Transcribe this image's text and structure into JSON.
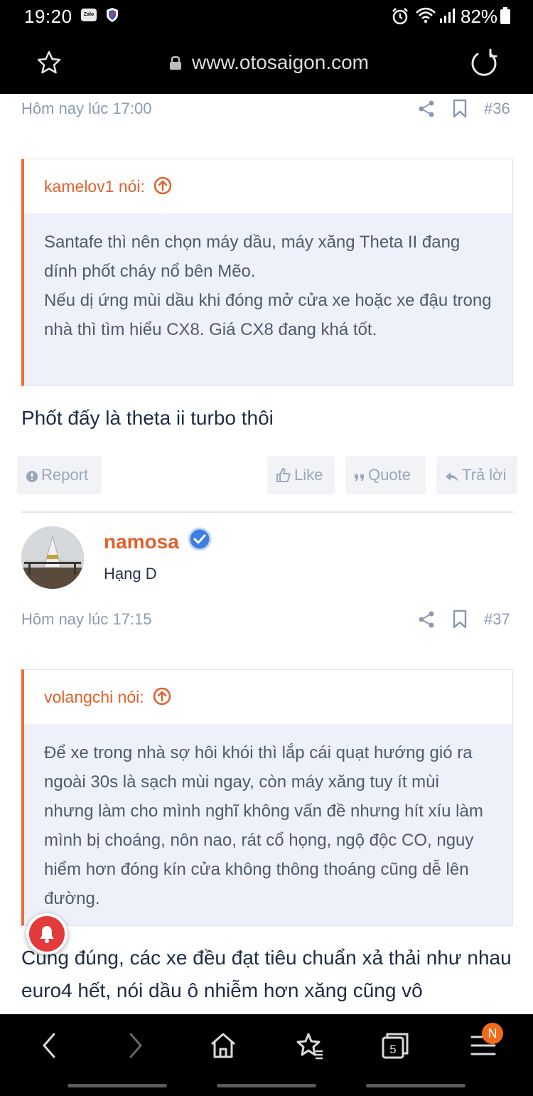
{
  "status_bar": {
    "time": "19:20",
    "zalo_label": "Zalo",
    "battery": "82%"
  },
  "url_bar": {
    "url": "www.otosaigon.com"
  },
  "post36": {
    "time": "Hôm nay lúc 17:00",
    "number": "#36",
    "quote_author": "kamelov1 nói:",
    "quote_text": "Santafe thì nên chọn máy dầu, máy xăng Theta II đang dính phốt cháy nổ bên Mẽo.\nNếu dị ứng mùi dầu khi đóng mở cửa xe hoặc xe đậu trong nhà thì tìm hiểu CX8. Giá CX8 đang khá tốt.",
    "reply_text": "Phốt đấy là theta ii turbo thôi",
    "actions": {
      "report": "Report",
      "like": "Like",
      "quote": "Quote",
      "reply": "Trả lời"
    }
  },
  "post37": {
    "username": "namosa",
    "rank": "Hạng D",
    "time": "Hôm nay lúc 17:15",
    "number": "#37",
    "quote_author": "volangchi nói:",
    "quote_text": "Để xe trong nhà sợ hôi khói thì lắp cái quạt hướng gió ra ngoài 30s là sạch mùi ngay, còn máy xăng tuy ít mùi nhưng làm cho mình nghĩ không vấn đề nhưng hít xíu làm mình bị choáng, nôn nao, rát cổ họng, ngộ độc CO, nguy hiểm hơn đóng kín cửa không thông thoáng cũng dễ lên đường.",
    "reply_text": "Cũng đúng, các xe đều đạt tiêu chuẩn xả thải như nhau euro4 hết, nói dầu ô nhiễm hơn xăng cũng vô"
  },
  "bottom_nav": {
    "tabs_count": "5",
    "menu_badge": "N"
  },
  "colors": {
    "accent": "#e0612c",
    "quote_bg": "#eef1f9",
    "meta_text": "#8c9ab0",
    "verified": "#3d7fe0",
    "bell": "#e33b3b"
  }
}
